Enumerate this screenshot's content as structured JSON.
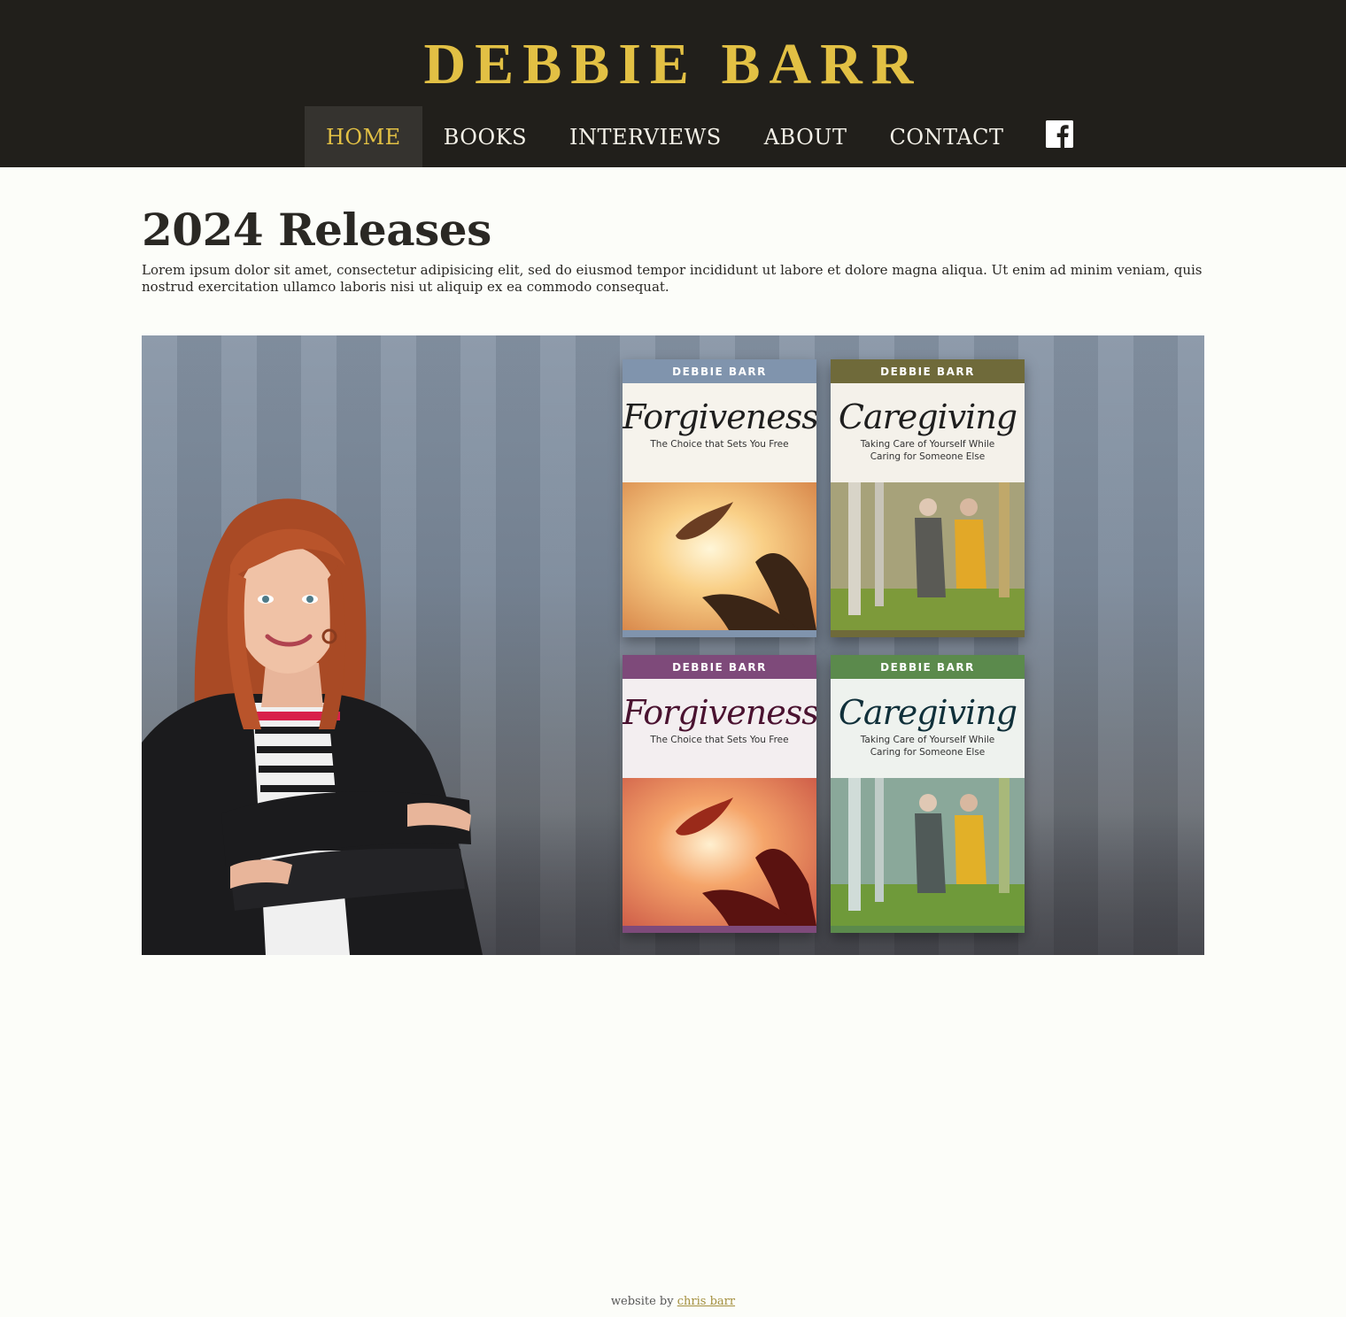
{
  "header": {
    "site_title": "DEBBIE BARR",
    "nav": [
      {
        "label": "HOME",
        "active": true
      },
      {
        "label": "BOOKS",
        "active": false
      },
      {
        "label": "INTERVIEWS",
        "active": false
      },
      {
        "label": "ABOUT",
        "active": false
      },
      {
        "label": "CONTACT",
        "active": false
      }
    ],
    "social_icon": "facebook-icon"
  },
  "main": {
    "heading": "2024 Releases",
    "intro": "Lorem ipsum dolor sit amet, consectetur adipisicing elit, sed do eiusmod tempor incididunt ut labore et dolore magna aliqua. Ut enim ad minim veniam, quis nostrud exercitation ullamco laboris nisi ut aliquip ex ea commodo consequat.",
    "books": [
      {
        "author": "DEBBIE BARR",
        "title": "Forgiveness",
        "subtitle": "The Choice that Sets You Free",
        "band_color": "#8094ad",
        "title_color": "#1e1e1e"
      },
      {
        "author": "DEBBIE BARR",
        "title": "Caregiving",
        "subtitle": "Taking Care of Yourself While Caring for Someone Else",
        "band_color": "#6f6a3a",
        "title_color": "#1e1e1e"
      },
      {
        "author": "DEBBIE BARR",
        "title": "Forgiveness",
        "subtitle": "The Choice that Sets You Free",
        "band_color": "#7e4a7a",
        "title_color": "#4a1230"
      },
      {
        "author": "DEBBIE BARR",
        "title": "Caregiving",
        "subtitle": "Taking Care of Yourself While Caring for Someone Else",
        "band_color": "#5b8a4c",
        "title_color": "#10303a"
      }
    ]
  },
  "footer": {
    "prefix": "website by",
    "link_text": "chris barr"
  },
  "colors": {
    "header_bg": "#211f1b",
    "accent_gold": "#e2c044",
    "page_bg": "#fcfdf9"
  }
}
